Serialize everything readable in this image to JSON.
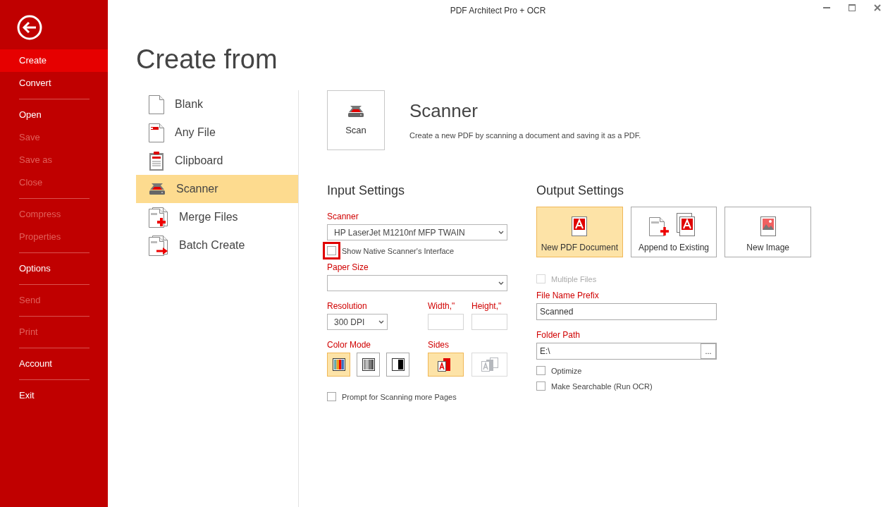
{
  "window": {
    "title": "PDF Architect Pro + OCR"
  },
  "sidebar": {
    "groups": [
      [
        {
          "label": "Create",
          "selected": true,
          "disabled": false
        },
        {
          "label": "Convert",
          "selected": false,
          "disabled": false
        }
      ],
      [
        {
          "label": "Open",
          "selected": false,
          "disabled": false
        },
        {
          "label": "Save",
          "selected": false,
          "disabled": true
        },
        {
          "label": "Save as",
          "selected": false,
          "disabled": true
        },
        {
          "label": "Close",
          "selected": false,
          "disabled": true
        }
      ],
      [
        {
          "label": "Compress",
          "selected": false,
          "disabled": true
        },
        {
          "label": "Properties",
          "selected": false,
          "disabled": true
        }
      ],
      [
        {
          "label": "Options",
          "selected": false,
          "disabled": false
        }
      ],
      [
        {
          "label": "Send",
          "selected": false,
          "disabled": true
        }
      ],
      [
        {
          "label": "Print",
          "selected": false,
          "disabled": true
        }
      ],
      [
        {
          "label": "Account",
          "selected": false,
          "disabled": false
        }
      ],
      [
        {
          "label": "Exit",
          "selected": false,
          "disabled": false
        }
      ]
    ]
  },
  "page_title": "Create from",
  "sources": [
    {
      "label": "Blank",
      "selected": false
    },
    {
      "label": "Any File",
      "selected": false
    },
    {
      "label": "Clipboard",
      "selected": false
    },
    {
      "label": "Scanner",
      "selected": true
    },
    {
      "label": "Merge Files",
      "selected": false
    },
    {
      "label": "Batch Create",
      "selected": false
    }
  ],
  "action": {
    "button": "Scan",
    "title": "Scanner",
    "description": "Create a new PDF by scanning a document and saving it as a PDF."
  },
  "input_settings": {
    "heading": "Input Settings",
    "scanner": {
      "label": "Scanner",
      "value": "HP LaserJet M1210nf MFP TWAIN"
    },
    "native_interface": {
      "label": "Show Native Scanner's Interface",
      "checked": false,
      "highlighted": true
    },
    "paper_size": {
      "label": "Paper Size"
    },
    "resolution": {
      "label": "Resolution",
      "value": "300 DPI"
    },
    "width": {
      "label": "Width,\""
    },
    "height": {
      "label": "Height,\""
    },
    "color_mode": {
      "label": "Color Mode",
      "options": [
        {
          "selected": true
        },
        {
          "selected": false
        },
        {
          "selected": false
        }
      ]
    },
    "sides": {
      "label": "Sides",
      "options": [
        {
          "selected": true,
          "disabled": false
        },
        {
          "selected": false,
          "disabled": true
        }
      ]
    },
    "prompt_more_pages": {
      "label": "Prompt for Scanning more Pages",
      "checked": false
    }
  },
  "output_settings": {
    "heading": "Output Settings",
    "targets": [
      {
        "label": "New PDF Document",
        "selected": true
      },
      {
        "label": "Append to Existing",
        "selected": false
      },
      {
        "label": "New Image",
        "selected": false
      }
    ],
    "multiple_files": {
      "label": "Multiple Files",
      "checked": false,
      "disabled": true
    },
    "prefix": {
      "label": "File Name Prefix",
      "value": "Scanned"
    },
    "folder": {
      "label": "Folder Path",
      "value": "E:\\",
      "browse": "..."
    },
    "optimize": {
      "label": "Optimize",
      "checked": false
    },
    "searchable": {
      "label": "Make Searchable (Run OCR)",
      "checked": false
    }
  }
}
